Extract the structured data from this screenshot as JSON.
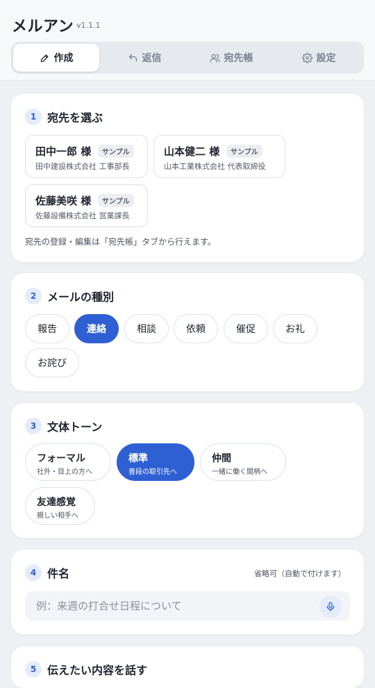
{
  "app": {
    "title": "メルアン",
    "version": "v1.1.1"
  },
  "tabs": [
    {
      "label": "作成",
      "icon": "pencil-icon",
      "active": true
    },
    {
      "label": "返信",
      "icon": "reply-icon",
      "active": false
    },
    {
      "label": "宛先帳",
      "icon": "users-icon",
      "active": false
    },
    {
      "label": "設定",
      "icon": "gear-icon",
      "active": false
    }
  ],
  "step1": {
    "number": "1",
    "title": "宛先を選ぶ",
    "contacts": [
      {
        "name": "田中一郎 様",
        "badge": "サンプル",
        "company": "田中建設株式会社 工事部長"
      },
      {
        "name": "山本健二 様",
        "badge": "サンプル",
        "company": "山本工業株式会社 代表取締役"
      },
      {
        "name": "佐藤美咲 様",
        "badge": "サンプル",
        "company": "佐藤設備株式会社 営業課長"
      }
    ],
    "hint": "宛先の登録・編集は「宛先帳」タブから行えます。"
  },
  "step2": {
    "number": "2",
    "title": "メールの種別",
    "types": [
      "報告",
      "連絡",
      "相談",
      "依頼",
      "催促",
      "お礼",
      "お詫び"
    ],
    "selected": "連絡"
  },
  "step3": {
    "number": "3",
    "title": "文体トーン",
    "tones": [
      {
        "label": "フォーマル",
        "desc": "社外・目上の方へ"
      },
      {
        "label": "標準",
        "desc": "普段の取引先へ"
      },
      {
        "label": "仲間",
        "desc": "一緒に働く間柄へ"
      },
      {
        "label": "友達感覚",
        "desc": "親しい相手へ"
      }
    ],
    "selected": "標準"
  },
  "step4": {
    "number": "4",
    "title": "件名",
    "optional_note": "省略可（自動で付けます）",
    "subject_value": "",
    "subject_placeholder": "例：来週の打合せ日程について",
    "mic_icon": "microphone-icon"
  },
  "step5": {
    "number": "5",
    "title": "伝えたい内容を話す"
  },
  "colors": {
    "accent": "#2e5fd3",
    "accent_soft": "#e4ecfb",
    "background": "#eef0f4"
  }
}
